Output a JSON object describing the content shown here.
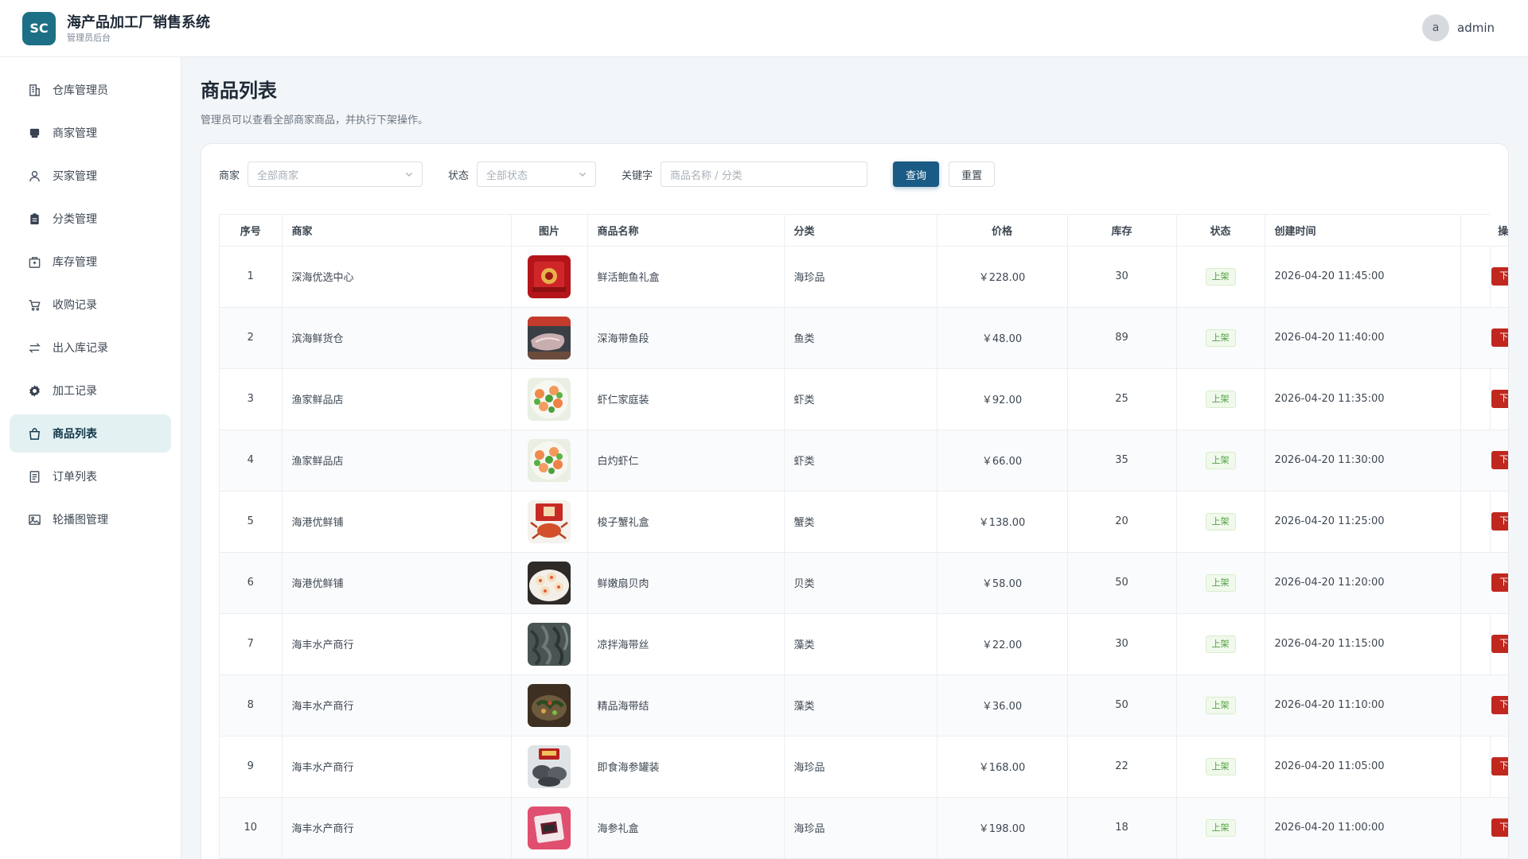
{
  "header": {
    "logo_text": "SC",
    "title": "海产品加工厂销售系统",
    "subtitle": "管理员后台",
    "avatar_letter": "a",
    "username": "admin"
  },
  "sidebar": {
    "items": [
      {
        "label": "仓库管理员",
        "icon": "building-icon"
      },
      {
        "label": "商家管理",
        "icon": "store-icon"
      },
      {
        "label": "买家管理",
        "icon": "user-icon"
      },
      {
        "label": "分类管理",
        "icon": "clipboard-icon"
      },
      {
        "label": "库存管理",
        "icon": "inventory-box-icon"
      },
      {
        "label": "收购记录",
        "icon": "cart-icon"
      },
      {
        "label": "出入库记录",
        "icon": "transfer-arrows-icon"
      },
      {
        "label": "加工记录",
        "icon": "gear-icon"
      },
      {
        "label": "商品列表",
        "icon": "shopping-bag-icon",
        "active": true
      },
      {
        "label": "订单列表",
        "icon": "document-list-icon"
      },
      {
        "label": "轮播图管理",
        "icon": "image-icon"
      }
    ]
  },
  "page": {
    "title": "商品列表",
    "description": "管理员可以查看全部商家商品，并执行下架操作。"
  },
  "filters": {
    "merchant_label": "商家",
    "merchant_placeholder": "全部商家",
    "status_label": "状态",
    "status_placeholder": "全部状态",
    "keyword_label": "关键字",
    "keyword_placeholder": "商品名称 / 分类",
    "query_button": "查询",
    "reset_button": "重置"
  },
  "table": {
    "columns": [
      "序号",
      "商家",
      "图片",
      "商品名称",
      "分类",
      "价格",
      "库存",
      "状态",
      "创建时间",
      "操作"
    ],
    "rows": [
      {
        "no": "1",
        "merchant": "深海优选中心",
        "name": "鲜活鲍鱼礼盒",
        "category": "海珍品",
        "price": "￥228.00",
        "stock": "30",
        "status": "上架",
        "created": "2026-04-20 11:45:00",
        "action": "下架",
        "image": "abalone-gift-box"
      },
      {
        "no": "2",
        "merchant": "滨海鲜货仓",
        "name": "深海带鱼段",
        "category": "鱼类",
        "price": "￥48.00",
        "stock": "89",
        "status": "上架",
        "created": "2026-04-20 11:40:00",
        "action": "下架",
        "image": "hairtail-fish"
      },
      {
        "no": "3",
        "merchant": "渔家鲜品店",
        "name": "虾仁家庭装",
        "category": "虾类",
        "price": "￥92.00",
        "stock": "25",
        "status": "上架",
        "created": "2026-04-20 11:35:00",
        "action": "下架",
        "image": "shrimp-dish"
      },
      {
        "no": "4",
        "merchant": "渔家鲜品店",
        "name": "白灼虾仁",
        "category": "虾类",
        "price": "￥66.00",
        "stock": "35",
        "status": "上架",
        "created": "2026-04-20 11:30:00",
        "action": "下架",
        "image": "shrimp-dish"
      },
      {
        "no": "5",
        "merchant": "海港优鲜铺",
        "name": "梭子蟹礼盒",
        "category": "蟹类",
        "price": "￥138.00",
        "stock": "20",
        "status": "上架",
        "created": "2026-04-20 11:25:00",
        "action": "下架",
        "image": "crab-gift-box"
      },
      {
        "no": "6",
        "merchant": "海港优鲜铺",
        "name": "鲜嫩扇贝肉",
        "category": "贝类",
        "price": "￥58.00",
        "stock": "50",
        "status": "上架",
        "created": "2026-04-20 11:20:00",
        "action": "下架",
        "image": "scallop-plate"
      },
      {
        "no": "7",
        "merchant": "海丰水产商行",
        "name": "凉拌海带丝",
        "category": "藻类",
        "price": "￥22.00",
        "stock": "30",
        "status": "上架",
        "created": "2026-04-20 11:15:00",
        "action": "下架",
        "image": "kelp-shreds"
      },
      {
        "no": "8",
        "merchant": "海丰水产商行",
        "name": "精品海带结",
        "category": "藻类",
        "price": "￥36.00",
        "stock": "50",
        "status": "上架",
        "created": "2026-04-20 11:10:00",
        "action": "下架",
        "image": "kelp-knot-bowl"
      },
      {
        "no": "9",
        "merchant": "海丰水产商行",
        "name": "即食海参罐装",
        "category": "海珍品",
        "price": "￥168.00",
        "stock": "22",
        "status": "上架",
        "created": "2026-04-20 11:05:00",
        "action": "下架",
        "image": "sea-cucumber-can"
      },
      {
        "no": "10",
        "merchant": "海丰水产商行",
        "name": "海参礼盒",
        "category": "海珍品",
        "price": "￥198.00",
        "stock": "18",
        "status": "上架",
        "created": "2026-04-20 11:00:00",
        "action": "下架",
        "image": "sea-cucumber-gift"
      }
    ]
  },
  "colors": {
    "brand": "#1d6f86",
    "primary_button": "#1a5b86",
    "active_nav_bg": "#e3f1f2",
    "danger_button": "#c0281f",
    "status_tag_text": "#52a043"
  }
}
